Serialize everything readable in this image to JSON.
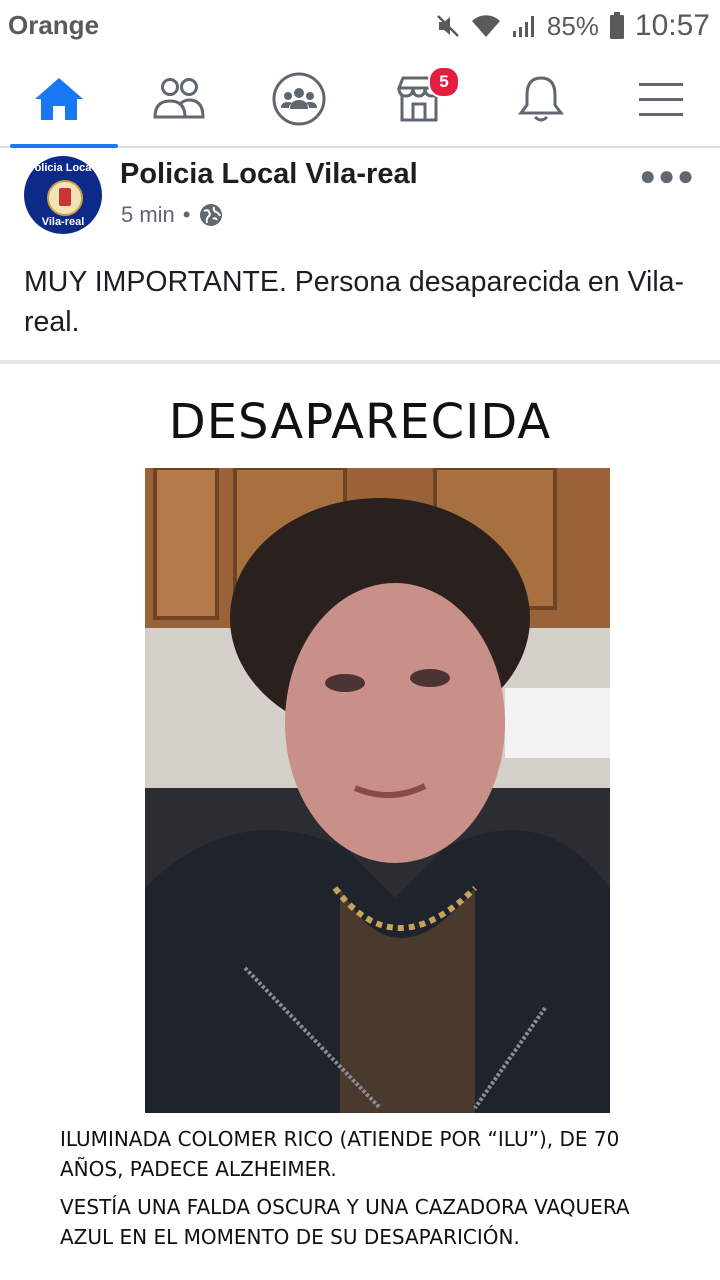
{
  "status_bar": {
    "carrier": "Orange",
    "battery_percent": "85%",
    "time": "10:57"
  },
  "top_nav": {
    "items": [
      {
        "name": "home",
        "icon": "home-icon",
        "active": true
      },
      {
        "name": "friends",
        "icon": "friends-icon"
      },
      {
        "name": "groups",
        "icon": "groups-icon"
      },
      {
        "name": "marketplace",
        "icon": "marketplace-icon",
        "badge": "5"
      },
      {
        "name": "notifications",
        "icon": "bell-icon"
      },
      {
        "name": "menu",
        "icon": "hamburger-menu-icon"
      }
    ],
    "accent_color": "#1877f2",
    "badge_color": "#e41e3f"
  },
  "post": {
    "page_name": "Policia Local Vila-real",
    "time_ago": "5 min",
    "separator": "•",
    "privacy_icon": "globe-icon",
    "avatar": {
      "text_top": "olicia Loca",
      "text_bottom": "Vila-real"
    },
    "text": "MUY IMPORTANTE. Persona desaparecida en Vila-real."
  },
  "poster": {
    "title": "DESAPARECIDA",
    "description_1": "ILUMINADA COLOMER RICO (ATIENDE POR “ILU”), DE 70 AÑOS, PADECE ALZHEIMER.",
    "description_2": "VESTÍA UNA FALDA OSCURA Y UNA CAZADORA VAQUERA AZUL EN EL MOMENTO DE SU DESAPARICIÓN."
  }
}
